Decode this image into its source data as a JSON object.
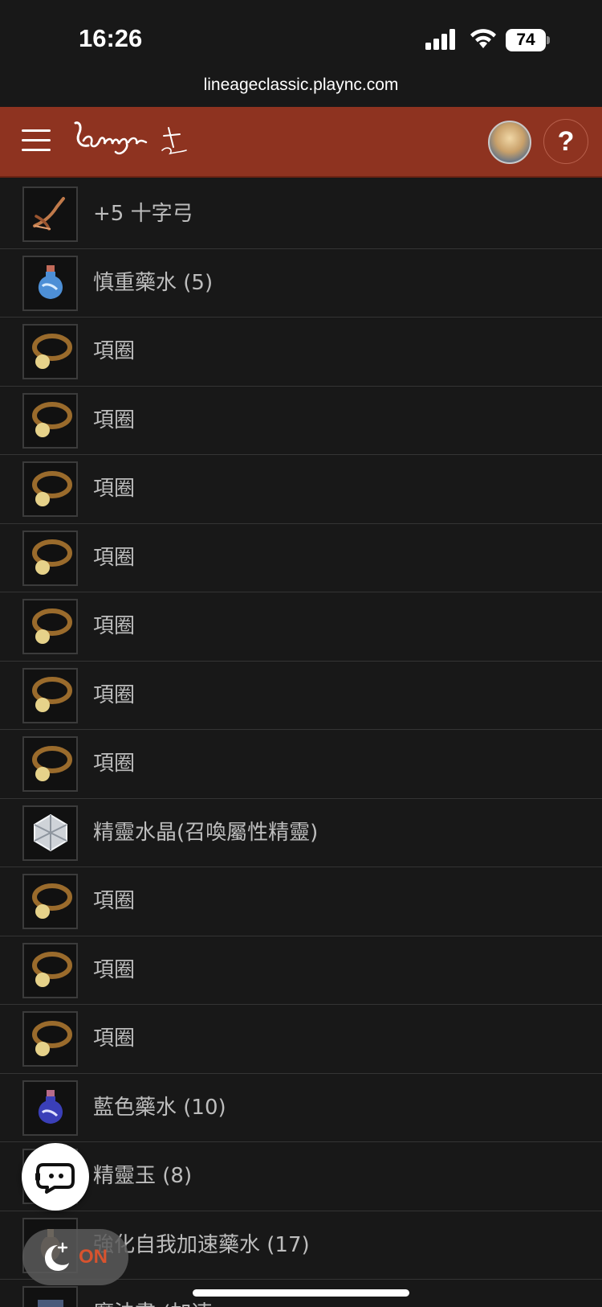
{
  "status_bar": {
    "time": "16:26",
    "battery": "74"
  },
  "browser": {
    "url": "lineageclassic.plaync.com"
  },
  "header": {
    "logo_alt": "Lineage Classic",
    "menu_icon": "hamburger-icon",
    "avatar_icon": "avatar",
    "help_label": "?"
  },
  "items": [
    {
      "label": "+5 十字弓",
      "icon": "crossbow-icon"
    },
    {
      "label": "慎重藥水 (5)",
      "icon": "potion-blue-icon"
    },
    {
      "label": "項圈",
      "icon": "collar-icon"
    },
    {
      "label": "項圈",
      "icon": "collar-icon"
    },
    {
      "label": "項圈",
      "icon": "collar-icon"
    },
    {
      "label": "項圈",
      "icon": "collar-icon"
    },
    {
      "label": "項圈",
      "icon": "collar-icon"
    },
    {
      "label": "項圈",
      "icon": "collar-icon"
    },
    {
      "label": "項圈",
      "icon": "collar-icon"
    },
    {
      "label": "精靈水晶(召喚屬性精靈)",
      "icon": "crystal-icon"
    },
    {
      "label": "項圈",
      "icon": "collar-icon"
    },
    {
      "label": "項圈",
      "icon": "collar-icon"
    },
    {
      "label": "項圈",
      "icon": "collar-icon"
    },
    {
      "label": "藍色藥水 (10)",
      "icon": "potion-darkblue-icon"
    },
    {
      "label": "精靈玉 (8)",
      "icon": "gem-icon"
    },
    {
      "label": "強化自我加速藥水 (17)",
      "icon": "potion-icon"
    },
    {
      "label": "魔法書 (加速",
      "icon": "book-icon"
    }
  ],
  "floating": {
    "night_mode_label": "ON"
  },
  "colors": {
    "header_bg": "#8e3320",
    "page_bg": "#181818",
    "accent_on": "#d8532e"
  }
}
